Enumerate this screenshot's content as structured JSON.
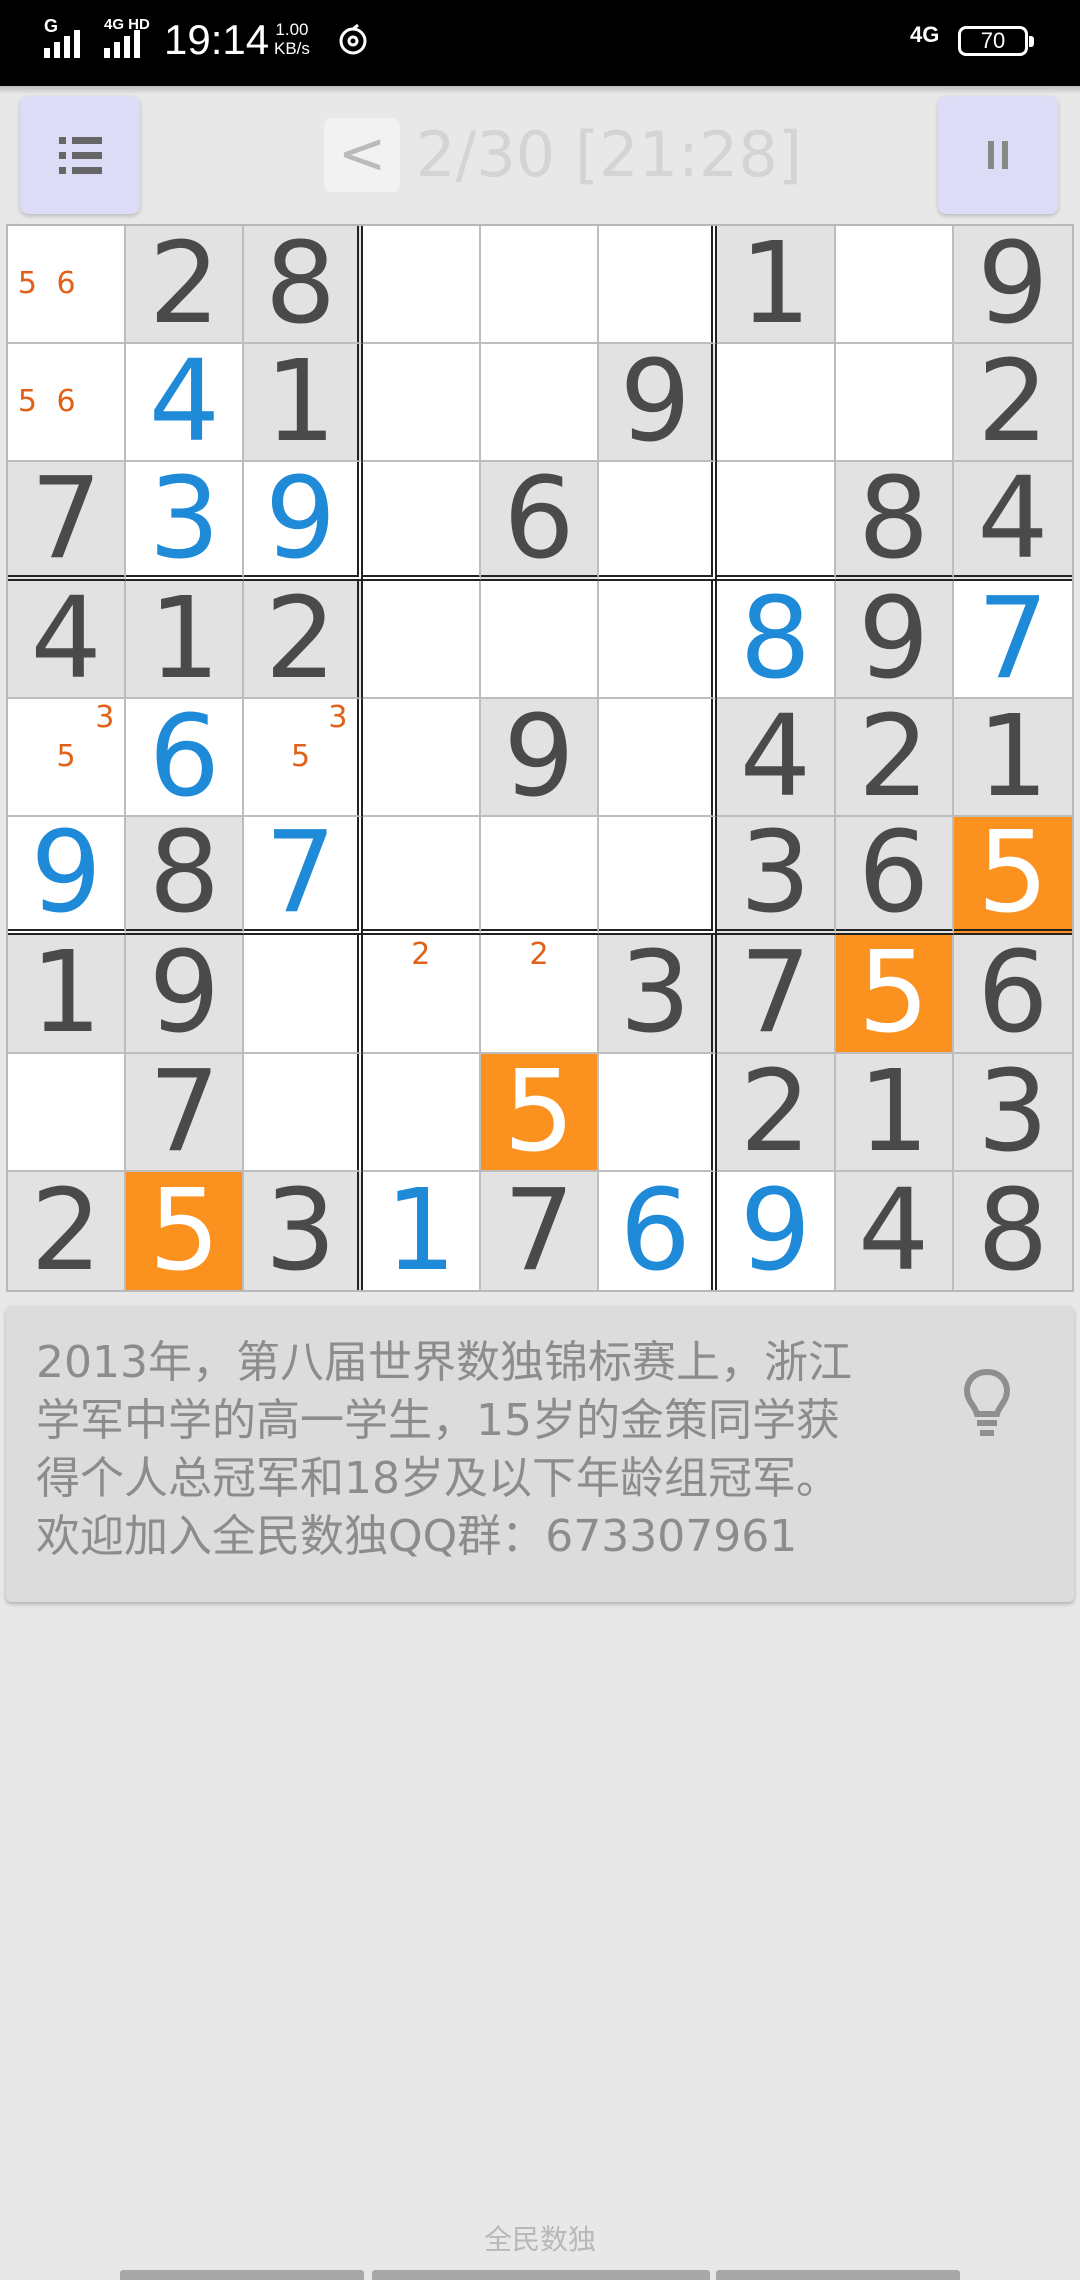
{
  "status_bar": {
    "signal1_label": "G",
    "signal2_label": "4G HD",
    "time": "19:14",
    "speed_value": "1.00",
    "speed_unit": "KB/s",
    "network": "4G",
    "battery": "70"
  },
  "header": {
    "back_label": "<",
    "title": "2/30 [21:28]"
  },
  "board": [
    [
      {
        "v": "",
        "n": [
          "",
          "",
          "",
          "5",
          "6",
          "",
          "",
          "",
          ""
        ]
      },
      {
        "v": "2",
        "t": "given"
      },
      {
        "v": "8",
        "t": "given"
      },
      {
        "v": ""
      },
      {
        "v": ""
      },
      {
        "v": ""
      },
      {
        "v": "1",
        "t": "given"
      },
      {
        "v": ""
      },
      {
        "v": "9",
        "t": "given"
      }
    ],
    [
      {
        "v": "",
        "n": [
          "",
          "",
          "",
          "5",
          "6",
          "",
          "",
          "",
          ""
        ]
      },
      {
        "v": "4",
        "t": "user"
      },
      {
        "v": "1",
        "t": "given"
      },
      {
        "v": ""
      },
      {
        "v": ""
      },
      {
        "v": "9",
        "t": "given"
      },
      {
        "v": ""
      },
      {
        "v": ""
      },
      {
        "v": "2",
        "t": "given"
      }
    ],
    [
      {
        "v": "7",
        "t": "given"
      },
      {
        "v": "3",
        "t": "user"
      },
      {
        "v": "9",
        "t": "user"
      },
      {
        "v": ""
      },
      {
        "v": "6",
        "t": "given"
      },
      {
        "v": ""
      },
      {
        "v": ""
      },
      {
        "v": "8",
        "t": "given"
      },
      {
        "v": "4",
        "t": "given"
      }
    ],
    [
      {
        "v": "4",
        "t": "given"
      },
      {
        "v": "1",
        "t": "given"
      },
      {
        "v": "2",
        "t": "given"
      },
      {
        "v": ""
      },
      {
        "v": ""
      },
      {
        "v": ""
      },
      {
        "v": "8",
        "t": "user"
      },
      {
        "v": "9",
        "t": "given"
      },
      {
        "v": "7",
        "t": "user"
      }
    ],
    [
      {
        "v": "",
        "n": [
          "",
          "",
          "3",
          "",
          "5",
          "",
          "",
          "",
          ""
        ]
      },
      {
        "v": "6",
        "t": "user"
      },
      {
        "v": "",
        "n": [
          "",
          "",
          "3",
          "",
          "5",
          "",
          "",
          "",
          ""
        ]
      },
      {
        "v": ""
      },
      {
        "v": "9",
        "t": "given"
      },
      {
        "v": ""
      },
      {
        "v": "4",
        "t": "given"
      },
      {
        "v": "2",
        "t": "given"
      },
      {
        "v": "1",
        "t": "given"
      }
    ],
    [
      {
        "v": "9",
        "t": "user"
      },
      {
        "v": "8",
        "t": "given"
      },
      {
        "v": "7",
        "t": "user"
      },
      {
        "v": ""
      },
      {
        "v": ""
      },
      {
        "v": ""
      },
      {
        "v": "3",
        "t": "given"
      },
      {
        "v": "6",
        "t": "given"
      },
      {
        "v": "5",
        "t": "hl"
      }
    ],
    [
      {
        "v": "1",
        "t": "given"
      },
      {
        "v": "9",
        "t": "given"
      },
      {
        "v": ""
      },
      {
        "v": "",
        "n": [
          "",
          "2",
          "",
          "",
          "",
          "",
          "",
          "",
          ""
        ]
      },
      {
        "v": "",
        "n": [
          "",
          "2",
          "",
          "",
          "",
          "",
          "",
          "",
          ""
        ]
      },
      {
        "v": "3",
        "t": "given"
      },
      {
        "v": "7",
        "t": "given"
      },
      {
        "v": "5",
        "t": "hl"
      },
      {
        "v": "6",
        "t": "given"
      }
    ],
    [
      {
        "v": ""
      },
      {
        "v": "7",
        "t": "given"
      },
      {
        "v": ""
      },
      {
        "v": ""
      },
      {
        "v": "5",
        "t": "hl"
      },
      {
        "v": ""
      },
      {
        "v": "2",
        "t": "given"
      },
      {
        "v": "1",
        "t": "given"
      },
      {
        "v": "3",
        "t": "given"
      }
    ],
    [
      {
        "v": "2",
        "t": "given"
      },
      {
        "v": "5",
        "t": "hl"
      },
      {
        "v": "3",
        "t": "given"
      },
      {
        "v": "1",
        "t": "user"
      },
      {
        "v": "7",
        "t": "given"
      },
      {
        "v": "6",
        "t": "user"
      },
      {
        "v": "9",
        "t": "user"
      },
      {
        "v": "4",
        "t": "given"
      },
      {
        "v": "8",
        "t": "given"
      }
    ]
  ],
  "tip": {
    "line1": "2013年，第八届世界数独锦标赛上，浙江",
    "line2": "学军中学的高一学生，15岁的金策同学获",
    "line3": "得个人总冠军和18岁及以下年龄组冠军。",
    "line4": "欢迎加入全民数独QQ群：673307961",
    "icon": "lightbulb-icon"
  },
  "footer": {
    "app_name": "全民数独"
  },
  "colors": {
    "highlight": "#fb9220",
    "user_digit": "#1e8ad8",
    "given_bg": "#e2e2e2",
    "note": "#e0621a"
  }
}
